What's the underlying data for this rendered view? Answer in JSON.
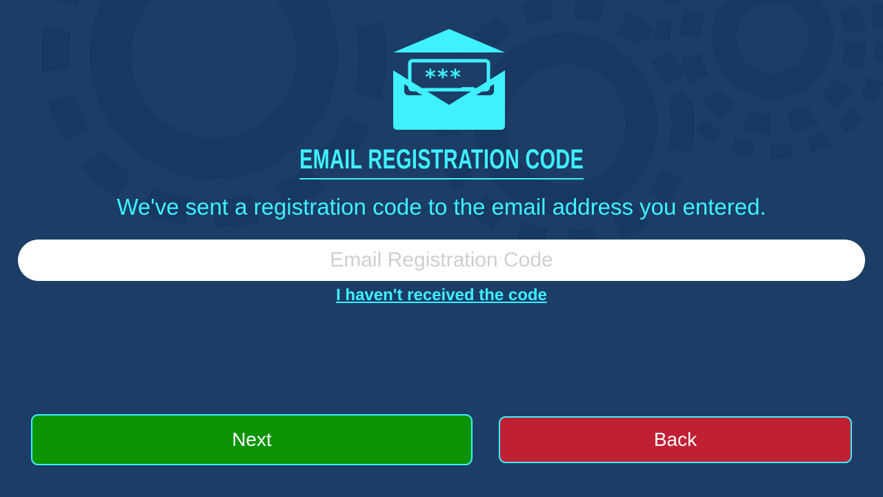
{
  "header": {
    "icon": "envelope-password-icon",
    "icon_text": "***_",
    "title": "EMAIL REGISTRATION CODE",
    "subtitle": "We've sent a registration code to the email address you entered."
  },
  "form": {
    "code_placeholder": "Email Registration Code",
    "code_value": "",
    "resend_link": "I haven't received the code"
  },
  "actions": {
    "next_label": "Next",
    "back_label": "Back"
  },
  "colors": {
    "background": "#1b3d66",
    "accent": "#3ff0ff",
    "next": "#0b9304",
    "back": "#c02034",
    "gears": "#173860"
  }
}
